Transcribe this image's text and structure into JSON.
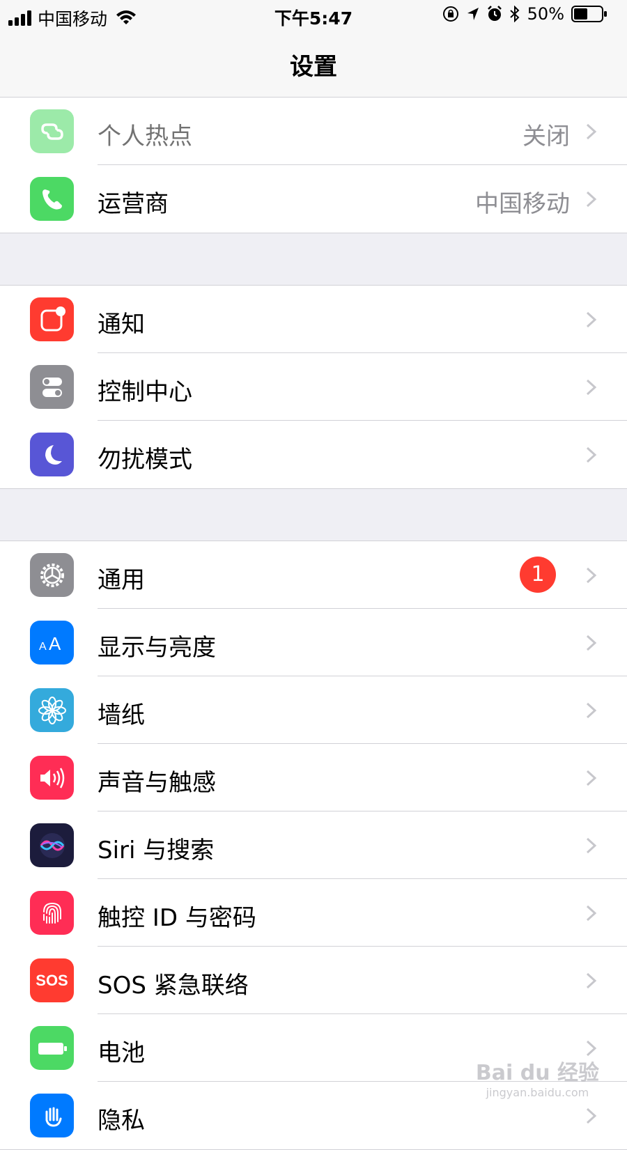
{
  "status_bar": {
    "carrier": "中国移动",
    "time": "下午5:47",
    "battery": "50%",
    "battery_level": 0.5
  },
  "nav": {
    "title": "设置"
  },
  "groups": [
    {
      "rows": [
        {
          "label": "个人热点",
          "value": "关闭",
          "icon": "hotspot-icon",
          "color": "#4cd964",
          "dim": true
        },
        {
          "label": "运营商",
          "value": "中国移动",
          "icon": "phone-icon",
          "color": "#4cd964"
        }
      ]
    },
    {
      "rows": [
        {
          "label": "通知",
          "icon": "notifications-icon",
          "color": "#ff3b30"
        },
        {
          "label": "控制中心",
          "icon": "control-center-icon",
          "color": "#8e8e93"
        },
        {
          "label": "勿扰模式",
          "icon": "moon-icon",
          "color": "#5856d6"
        }
      ]
    },
    {
      "rows": [
        {
          "label": "通用",
          "badge": "1",
          "icon": "gear-icon",
          "color": "#8e8e93"
        },
        {
          "label": "显示与亮度",
          "icon": "text-size-icon",
          "color": "#007aff"
        },
        {
          "label": "墙纸",
          "icon": "flower-icon",
          "color": "#34aadc"
        },
        {
          "label": "声音与触感",
          "icon": "speaker-icon",
          "color": "#ff2d55"
        },
        {
          "label": "Siri 与搜索",
          "icon": "siri-icon",
          "color": "#1c1c3c"
        },
        {
          "label": "触控 ID 与密码",
          "icon": "fingerprint-icon",
          "color": "#ff2d55"
        },
        {
          "label": "SOS 紧急联络",
          "icon": "sos-icon",
          "color": "#ff3b30",
          "icon_text": "SOS"
        },
        {
          "label": "电池",
          "icon": "battery-icon",
          "color": "#4cd964"
        },
        {
          "label": "隐私",
          "icon": "privacy-hand-icon",
          "color": "#007aff"
        }
      ]
    }
  ],
  "watermark": {
    "brand": "Bai du 经验",
    "url": "jingyan.baidu.com"
  }
}
